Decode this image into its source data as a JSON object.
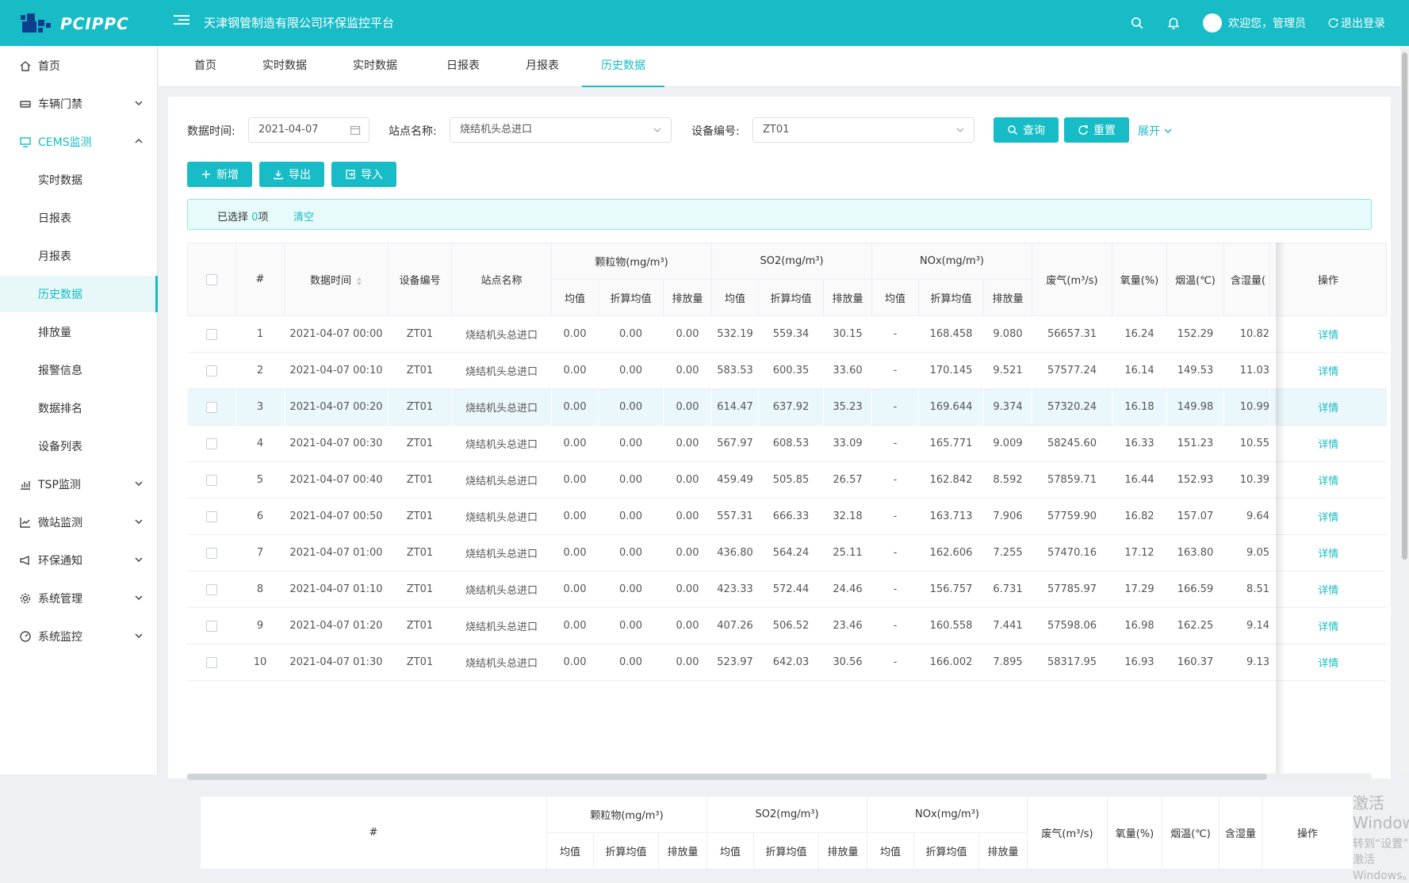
{
  "header": {
    "logo_text": "PCIPPC",
    "title": "天津钢管制造有限公司环保监控平台",
    "welcome": "欢迎您，管理员",
    "logout": "退出登录",
    "brand_color": "#17bcc7"
  },
  "sidebar": {
    "items": [
      {
        "label": "首页",
        "icon": "home-icon"
      },
      {
        "label": "车辆门禁",
        "icon": "car-icon"
      },
      {
        "label": "CEMS监测",
        "icon": "monitor-icon"
      },
      {
        "label": "实时数据"
      },
      {
        "label": "日报表"
      },
      {
        "label": "月报表"
      },
      {
        "label": "历史数据"
      },
      {
        "label": "排放量"
      },
      {
        "label": "报警信息"
      },
      {
        "label": "数据排名"
      },
      {
        "label": "设备列表"
      },
      {
        "label": "TSP监测",
        "icon": "bar-chart-icon"
      },
      {
        "label": "微站监测",
        "icon": "line-chart-icon"
      },
      {
        "label": "环保通知",
        "icon": "megaphone-icon"
      },
      {
        "label": "系统管理",
        "icon": "gear-icon"
      },
      {
        "label": "系统监控",
        "icon": "dashboard-icon"
      }
    ]
  },
  "tabs": [
    "首页",
    "实时数据",
    "实时数据",
    "日报表",
    "月报表",
    "历史数据"
  ],
  "filters": {
    "time_label": "数据时间:",
    "time_value": "2021-04-07",
    "site_label": "站点名称:",
    "site_value": "烧结机头总进口",
    "device_label": "设备编号:",
    "device_value": "ZT01",
    "query": "查询",
    "reset": "重置",
    "expand": "展开"
  },
  "toolbar": {
    "add": "新增",
    "export": "导出",
    "import": "导入"
  },
  "selection": {
    "prefix": "已选择",
    "count": "0",
    "suffix": "项",
    "clear": "清空"
  },
  "table": {
    "headers": {
      "index": "#",
      "time": "数据时间",
      "device": "设备编号",
      "site": "站点名称",
      "pm": "颗粒物(mg/m³)",
      "so2": "SO2(mg/m³)",
      "nox": "NOx(mg/m³)",
      "avg": "均值",
      "conv": "折算均值",
      "emis": "排放量",
      "flow": "废气(m³/s)",
      "o2": "氧量(%)",
      "temp": "烟温(℃)",
      "humid": "含湿量(",
      "humid2": "含湿量",
      "ops": "操作"
    },
    "detail_label": "详情",
    "rows": [
      [
        "1",
        "2021-04-07 00:00",
        "ZT01",
        "烧结机头总进口",
        "0.00",
        "0.00",
        "0.00",
        "532.19",
        "559.34",
        "30.15",
        "-",
        "168.458",
        "9.080",
        "56657.31",
        "16.24",
        "152.29",
        "10.82"
      ],
      [
        "2",
        "2021-04-07 00:10",
        "ZT01",
        "烧结机头总进口",
        "0.00",
        "0.00",
        "0.00",
        "583.53",
        "600.35",
        "33.60",
        "-",
        "170.145",
        "9.521",
        "57577.24",
        "16.14",
        "149.53",
        "11.03"
      ],
      [
        "3",
        "2021-04-07 00:20",
        "ZT01",
        "烧结机头总进口",
        "0.00",
        "0.00",
        "0.00",
        "614.47",
        "637.92",
        "35.23",
        "-",
        "169.644",
        "9.374",
        "57320.24",
        "16.18",
        "149.98",
        "10.99"
      ],
      [
        "4",
        "2021-04-07 00:30",
        "ZT01",
        "烧结机头总进口",
        "0.00",
        "0.00",
        "0.00",
        "567.97",
        "608.53",
        "33.09",
        "-",
        "165.771",
        "9.009",
        "58245.60",
        "16.33",
        "151.23",
        "10.55"
      ],
      [
        "5",
        "2021-04-07 00:40",
        "ZT01",
        "烧结机头总进口",
        "0.00",
        "0.00",
        "0.00",
        "459.49",
        "505.85",
        "26.57",
        "-",
        "162.842",
        "8.592",
        "57859.71",
        "16.44",
        "152.93",
        "10.39"
      ],
      [
        "6",
        "2021-04-07 00:50",
        "ZT01",
        "烧结机头总进口",
        "0.00",
        "0.00",
        "0.00",
        "557.31",
        "666.33",
        "32.18",
        "-",
        "163.713",
        "7.906",
        "57759.90",
        "16.82",
        "157.07",
        "9.64"
      ],
      [
        "7",
        "2021-04-07 01:00",
        "ZT01",
        "烧结机头总进口",
        "0.00",
        "0.00",
        "0.00",
        "436.80",
        "564.24",
        "25.11",
        "-",
        "162.606",
        "7.255",
        "57470.16",
        "17.12",
        "163.80",
        "9.05"
      ],
      [
        "8",
        "2021-04-07 01:10",
        "ZT01",
        "烧结机头总进口",
        "0.00",
        "0.00",
        "0.00",
        "423.33",
        "572.44",
        "24.46",
        "-",
        "156.757",
        "6.731",
        "57785.97",
        "17.29",
        "166.59",
        "8.51"
      ],
      [
        "9",
        "2021-04-07 01:20",
        "ZT01",
        "烧结机头总进口",
        "0.00",
        "0.00",
        "0.00",
        "407.26",
        "506.52",
        "23.46",
        "-",
        "160.558",
        "7.441",
        "57598.06",
        "16.98",
        "162.25",
        "9.14"
      ],
      [
        "10",
        "2021-04-07 01:30",
        "ZT01",
        "烧结机头总进口",
        "0.00",
        "0.00",
        "0.00",
        "523.97",
        "642.03",
        "30.56",
        "-",
        "166.002",
        "7.895",
        "58317.95",
        "16.93",
        "160.37",
        "9.13"
      ]
    ]
  },
  "watermark": {
    "line1": "激活 Windows",
    "line2": "转到“设置”以激活 Windows。"
  }
}
